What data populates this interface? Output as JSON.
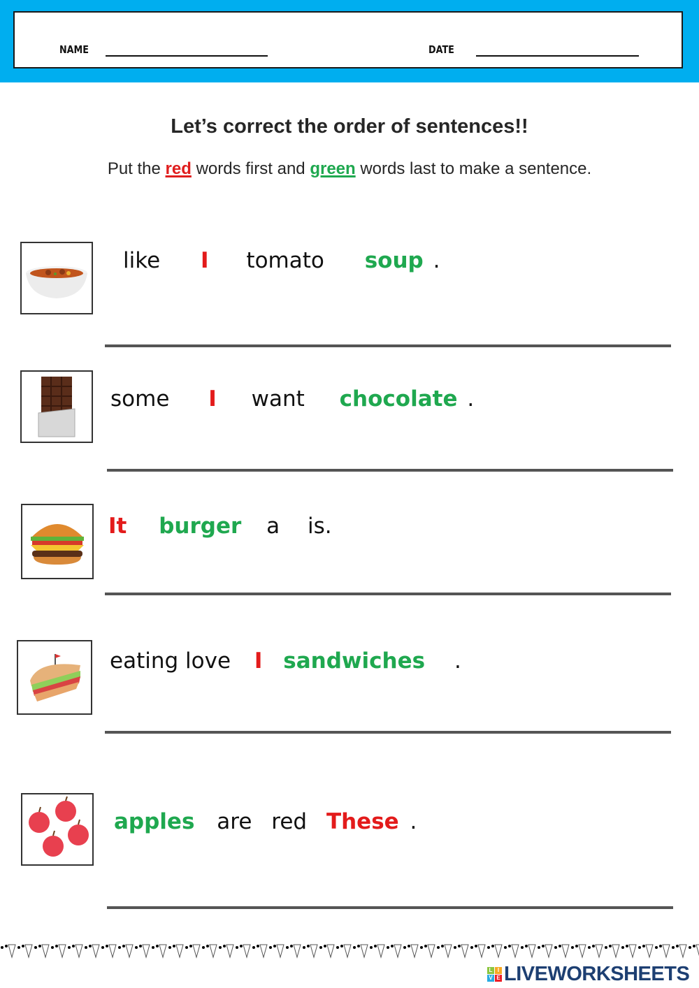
{
  "header": {
    "name_label": "NAME",
    "date_label": "DATE"
  },
  "title": "Let’s correct the order of sentences!!",
  "instruction": {
    "part1": "Put the ",
    "red_word": "red",
    "part2": " words first and ",
    "green_word": "green",
    "part3": " words last to make a sentence."
  },
  "colors": {
    "header_band": "#00aeef",
    "red": "#e31b1b",
    "green": "#1fa84f",
    "logo": "#1d3f72"
  },
  "exercises": [
    {
      "image": "soup-bowl",
      "words": [
        {
          "t": "like",
          "c": "black"
        },
        {
          "t": "I",
          "c": "red"
        },
        {
          "t": "tomato",
          "c": "black"
        },
        {
          "t": "soup",
          "c": "green"
        },
        {
          "t": ".",
          "c": "black"
        }
      ]
    },
    {
      "image": "chocolate-bar",
      "words": [
        {
          "t": "some",
          "c": "black"
        },
        {
          "t": "I",
          "c": "red"
        },
        {
          "t": "want",
          "c": "black"
        },
        {
          "t": "chocolate",
          "c": "green"
        },
        {
          "t": ".",
          "c": "black"
        }
      ]
    },
    {
      "image": "burger",
      "words": [
        {
          "t": "It",
          "c": "red"
        },
        {
          "t": "burger",
          "c": "green"
        },
        {
          "t": "a",
          "c": "black"
        },
        {
          "t": "is.",
          "c": "black"
        }
      ]
    },
    {
      "image": "sandwich",
      "words": [
        {
          "t": "eating love",
          "c": "black"
        },
        {
          "t": "I",
          "c": "red"
        },
        {
          "t": "sandwiches",
          "c": "green"
        },
        {
          "t": ".",
          "c": "black"
        }
      ]
    },
    {
      "image": "apples",
      "words": [
        {
          "t": "apples",
          "c": "green"
        },
        {
          "t": "are",
          "c": "black"
        },
        {
          "t": "red",
          "c": "black"
        },
        {
          "t": "These",
          "c": "red"
        },
        {
          "t": ".",
          "c": "black"
        }
      ]
    }
  ],
  "footer": {
    "logo_tiles": [
      "L",
      "I",
      "V",
      "E"
    ],
    "logo_text": "LIVEWORKSHEETS"
  }
}
